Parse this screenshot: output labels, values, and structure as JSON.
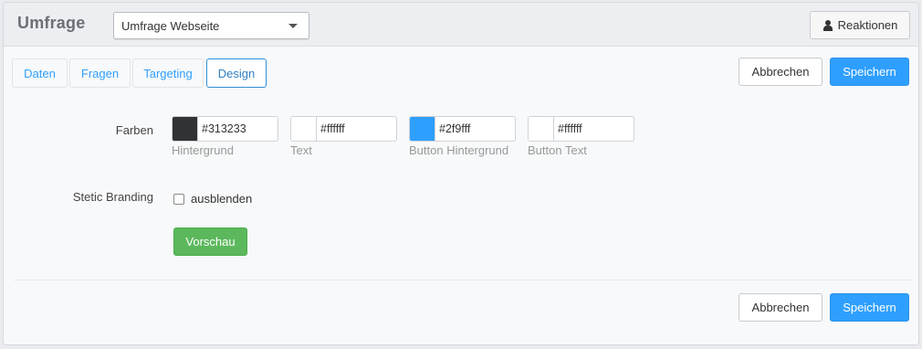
{
  "header": {
    "title": "Umfrage",
    "survey_select": {
      "value": "Umfrage Webseite"
    },
    "reactions_label": "Reaktionen"
  },
  "tabs": [
    {
      "label": "Daten",
      "active": false
    },
    {
      "label": "Fragen",
      "active": false
    },
    {
      "label": "Targeting",
      "active": false
    },
    {
      "label": "Design",
      "active": true
    }
  ],
  "actions": {
    "cancel_label": "Abbrechen",
    "save_label": "Speichern"
  },
  "colors": {
    "label": "Farben",
    "fields": [
      {
        "value": "#313233",
        "help": "Hintergrund",
        "swatch": "#313233"
      },
      {
        "value": "#ffffff",
        "help": "Text",
        "swatch": "#ffffff"
      },
      {
        "value": "#2f9fff",
        "help": "Button Hintergrund",
        "swatch": "#2f9fff"
      },
      {
        "value": "#ffffff",
        "help": "Button Text",
        "swatch": "#ffffff"
      }
    ]
  },
  "branding": {
    "label": "Stetic Branding",
    "checkbox_label": "ausblenden",
    "checked": false
  },
  "preview_label": "Vorschau",
  "theme": {
    "accent": "#2f9fff",
    "success": "#5cb85c"
  }
}
